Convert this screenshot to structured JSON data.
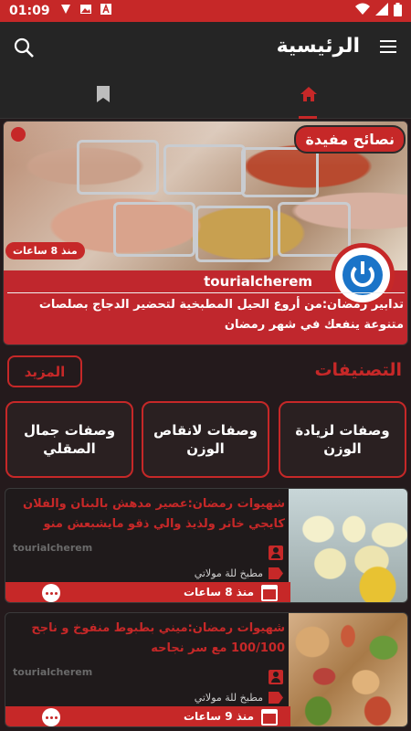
{
  "status_bar": {
    "time": "01:09",
    "icons": [
      "notification-icon",
      "image-icon",
      "a-icon"
    ],
    "right_icons": [
      "wifi-icon",
      "signal-icon",
      "battery-icon"
    ]
  },
  "app_bar": {
    "title": "الرئيسية",
    "icons": [
      "menu-icon",
      "search-icon"
    ]
  },
  "tabs": [
    {
      "name": "home",
      "icon": "home-icon",
      "active": true
    },
    {
      "name": "bookmarks",
      "icon": "bookmark-icon",
      "active": false
    }
  ],
  "featured": {
    "badge": "نصائح مفيدة",
    "time": "منذ 8 ساعات",
    "author": "tourialcherem",
    "description": "تدابير رمضان:من أروع الحيل المطبخية لتحضير الدجاج بصلصات متنوعة ينفعك في شهر رمضان"
  },
  "categories": {
    "title": "التصنيفات",
    "more_label": "المزيد",
    "items": [
      {
        "label": "وصفات لزيادة الوزن"
      },
      {
        "label": "وصفات لانقاص الوزن"
      },
      {
        "label": "وصفات جمال الصقلي"
      }
    ]
  },
  "posts": [
    {
      "title": "شهيوات رمضان:عصير مدهش بالبنان والفلان كايجي خاتر ولذيذ والي ذقو مايشبعش منو",
      "watermark": "tourialcherem",
      "category": "مطبخ للة مولاتي",
      "time": "منذ 8 ساعات"
    },
    {
      "title": "شهيوات رمضان:ميني بطبوط منفوخ و ناجح 100/100 مع سر نجاحه",
      "watermark": "tourialcherem",
      "category": "مطبخ للة مولاتي",
      "time": "منذ 9 ساعات"
    }
  ],
  "colors": {
    "accent": "#c62828",
    "background": "#241a1c",
    "bar": "#252525"
  }
}
